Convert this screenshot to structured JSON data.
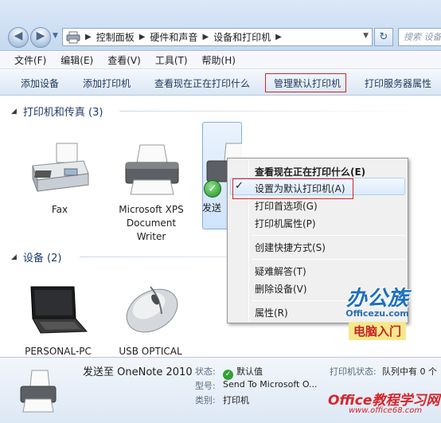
{
  "breadcrumb": [
    "控制面板",
    "硬件和声音",
    "设备和打印机"
  ],
  "search": {
    "placeholder": "搜索 设备"
  },
  "menu": [
    "文件(F)",
    "编辑(E)",
    "查看(V)",
    "工具(T)",
    "帮助(H)"
  ],
  "commands": [
    "添加设备",
    "添加打印机",
    "查看现在正在打印什么",
    "管理默认打印机",
    "打印服务器属性"
  ],
  "groups": {
    "printers": {
      "label": "打印机和传真 (3)"
    },
    "devices": {
      "label": "设备 (2)"
    }
  },
  "printers": [
    {
      "name": "Fax"
    },
    {
      "name_lines": [
        "Microsoft XPS",
        "Document",
        "Writer"
      ]
    },
    {
      "name": "发送"
    }
  ],
  "devices": [
    {
      "name": "PERSONAL-PC"
    },
    {
      "name": "USB OPTICAL"
    }
  ],
  "context_menu": {
    "items": [
      "查看现在正在打印什么(E)",
      "设置为默认打印机(A)",
      "打印首选项(G)",
      "打印机属性(P)",
      "创建快捷方式(S)",
      "疑难解答(T)",
      "删除设备(V)",
      "属性(R)"
    ],
    "checked_index": 1
  },
  "details": {
    "name": "发送至 OneNote 2010",
    "status_label": "状态:",
    "status_value": "默认值",
    "model_label": "型号:",
    "model_value": "Send To Microsoft O...",
    "category_label": "类别:",
    "category_value": "打印机",
    "printer_status_label": "打印机状态:",
    "printer_status_value": "队列中有 0 个"
  },
  "watermarks": {
    "brand1": "办公族",
    "brand1_url": "Officezu.com",
    "brand1_sub": "电脑入门",
    "brand2": "Office教程学习网",
    "brand2_url": "www.office68.com"
  },
  "colors": {
    "highlight": "#d8232a",
    "group_header": "#1e3b6a"
  }
}
